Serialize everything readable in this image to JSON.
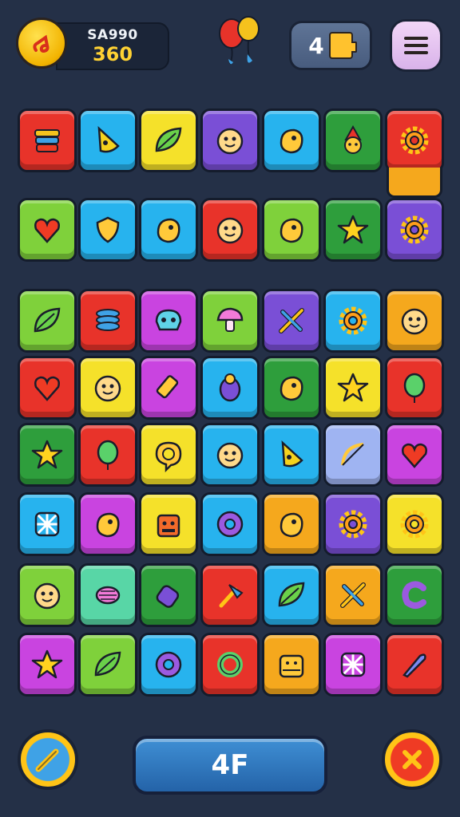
{
  "hud": {
    "score_label": "SA990",
    "score_value": "360",
    "lives_value": "4",
    "coin_icon": "coin-icon",
    "balloons_icon": "balloons-icon",
    "menu_icon": "hamburger-icon"
  },
  "board": {
    "tiles": [
      {
        "color": "#e8332a",
        "icon": "stacked-cups-icon",
        "shape": "cups"
      },
      {
        "color": "#27b3ee",
        "icon": "cheese-wedge-icon",
        "shape": "wedge"
      },
      {
        "color": "#f5e12a",
        "icon": "leaf-icon",
        "shape": "leaf"
      },
      {
        "color": "#7a4fd6",
        "icon": "purple-monster-icon",
        "shape": "face"
      },
      {
        "color": "#27b3ee",
        "icon": "lemon-icon",
        "shape": "blob"
      },
      {
        "color": "#2e9e3c",
        "icon": "gnome-icon",
        "shape": "gnome"
      },
      {
        "color": "#e8332a",
        "icon": "gear-icon",
        "shape": "gear"
      },
      {
        "color": "#7fd13b",
        "icon": "heart-icon",
        "shape": "heart"
      },
      {
        "color": "#27b3ee",
        "icon": "shield-icon",
        "shape": "shield"
      },
      {
        "color": "#27b3ee",
        "icon": "splat-icon",
        "shape": "blob"
      },
      {
        "color": "#e8332a",
        "icon": "smiley-face-icon",
        "shape": "face"
      },
      {
        "color": "#7fd13b",
        "icon": "lime-icon",
        "shape": "blob"
      },
      {
        "color": "#2e9e3c",
        "icon": "star-icon",
        "shape": "star"
      },
      {
        "color": "#7a4fd6",
        "icon": "gear-icon",
        "shape": "gear"
      },
      {
        "color": "#7fd13b",
        "icon": "purple-leaf-icon",
        "shape": "leaf"
      },
      {
        "color": "#e8332a",
        "icon": "coil-icon",
        "shape": "coil"
      },
      {
        "color": "#c944e0",
        "icon": "skull-icon",
        "shape": "skull"
      },
      {
        "color": "#7fd13b",
        "icon": "mushroom-icon",
        "shape": "mushroom"
      },
      {
        "color": "#7a4fd6",
        "icon": "crossed-tools-icon",
        "shape": "cross"
      },
      {
        "color": "#27b3ee",
        "icon": "gear-icon",
        "shape": "gear"
      },
      {
        "color": "#f5a81d",
        "icon": "cute-face-icon",
        "shape": "face"
      },
      {
        "color": "#e8332a",
        "icon": "heart-icon",
        "shape": "heart"
      },
      {
        "color": "#f5e12a",
        "icon": "pink-face-icon",
        "shape": "face"
      },
      {
        "color": "#c944e0",
        "icon": "crayon-icon",
        "shape": "crayon"
      },
      {
        "color": "#27b3ee",
        "icon": "beetle-icon",
        "shape": "beetle"
      },
      {
        "color": "#2e9e3c",
        "icon": "eye-bug-icon",
        "shape": "blob"
      },
      {
        "color": "#f5e12a",
        "icon": "star-icon",
        "shape": "star"
      },
      {
        "color": "#e8332a",
        "icon": "balloon-icon",
        "shape": "balloon"
      },
      {
        "color": "#2e9e3c",
        "icon": "star-icon",
        "shape": "star"
      },
      {
        "color": "#e8332a",
        "icon": "balloon-icon",
        "shape": "balloon"
      },
      {
        "color": "#f5e12a",
        "icon": "speech-bubble-icon",
        "shape": "bubble"
      },
      {
        "color": "#27b3ee",
        "icon": "penguin-icon",
        "shape": "face"
      },
      {
        "color": "#27b3ee",
        "icon": "cheese-wedge-icon",
        "shape": "wedge"
      },
      {
        "color": "#9fb4f2",
        "icon": "bow-arrow-icon",
        "shape": "bow"
      },
      {
        "color": "#c944e0",
        "icon": "heart-icon",
        "shape": "heart"
      },
      {
        "color": "#27b3ee",
        "icon": "knot-icon",
        "shape": "knot"
      },
      {
        "color": "#c944e0",
        "icon": "orange-fruit-icon",
        "shape": "blob"
      },
      {
        "color": "#f5e12a",
        "icon": "robot-icon",
        "shape": "robot"
      },
      {
        "color": "#27b3ee",
        "icon": "purple-flower-icon",
        "shape": "flower"
      },
      {
        "color": "#f5a81d",
        "icon": "lemon-icon",
        "shape": "blob"
      },
      {
        "color": "#7a4fd6",
        "icon": "gear-icon",
        "shape": "gear"
      },
      {
        "color": "#f5e12a",
        "icon": "gear-icon",
        "shape": "gear"
      },
      {
        "color": "#7fd13b",
        "icon": "red-blob-face-icon",
        "shape": "face"
      },
      {
        "color": "#58d6a6",
        "icon": "candy-icon",
        "shape": "candy"
      },
      {
        "color": "#2e9e3c",
        "icon": "potion-icon",
        "shape": "potion"
      },
      {
        "color": "#e8332a",
        "icon": "hammer-icon",
        "shape": "hammer"
      },
      {
        "color": "#27b3ee",
        "icon": "feather-icon",
        "shape": "leaf"
      },
      {
        "color": "#f5a81d",
        "icon": "crossed-tools-icon",
        "shape": "cross"
      },
      {
        "color": "#2e9e3c",
        "icon": "letter-c-icon",
        "shape": "c"
      },
      {
        "color": "#c944e0",
        "icon": "star-icon",
        "shape": "star"
      },
      {
        "color": "#7fd13b",
        "icon": "purple-leaf-icon",
        "shape": "leaf"
      },
      {
        "color": "#27b3ee",
        "icon": "purple-flower-icon",
        "shape": "flower"
      },
      {
        "color": "#e8332a",
        "icon": "green-ring-icon",
        "shape": "ring"
      },
      {
        "color": "#f5a81d",
        "icon": "treasure-chest-icon",
        "shape": "chest"
      },
      {
        "color": "#c944e0",
        "icon": "knot-icon",
        "shape": "knot"
      },
      {
        "color": "#e8332a",
        "icon": "rocket-icon",
        "shape": "rocket"
      }
    ]
  },
  "footer": {
    "left_icon": "pencil-icon",
    "center_label": "4F",
    "right_icon": "close-icon"
  }
}
